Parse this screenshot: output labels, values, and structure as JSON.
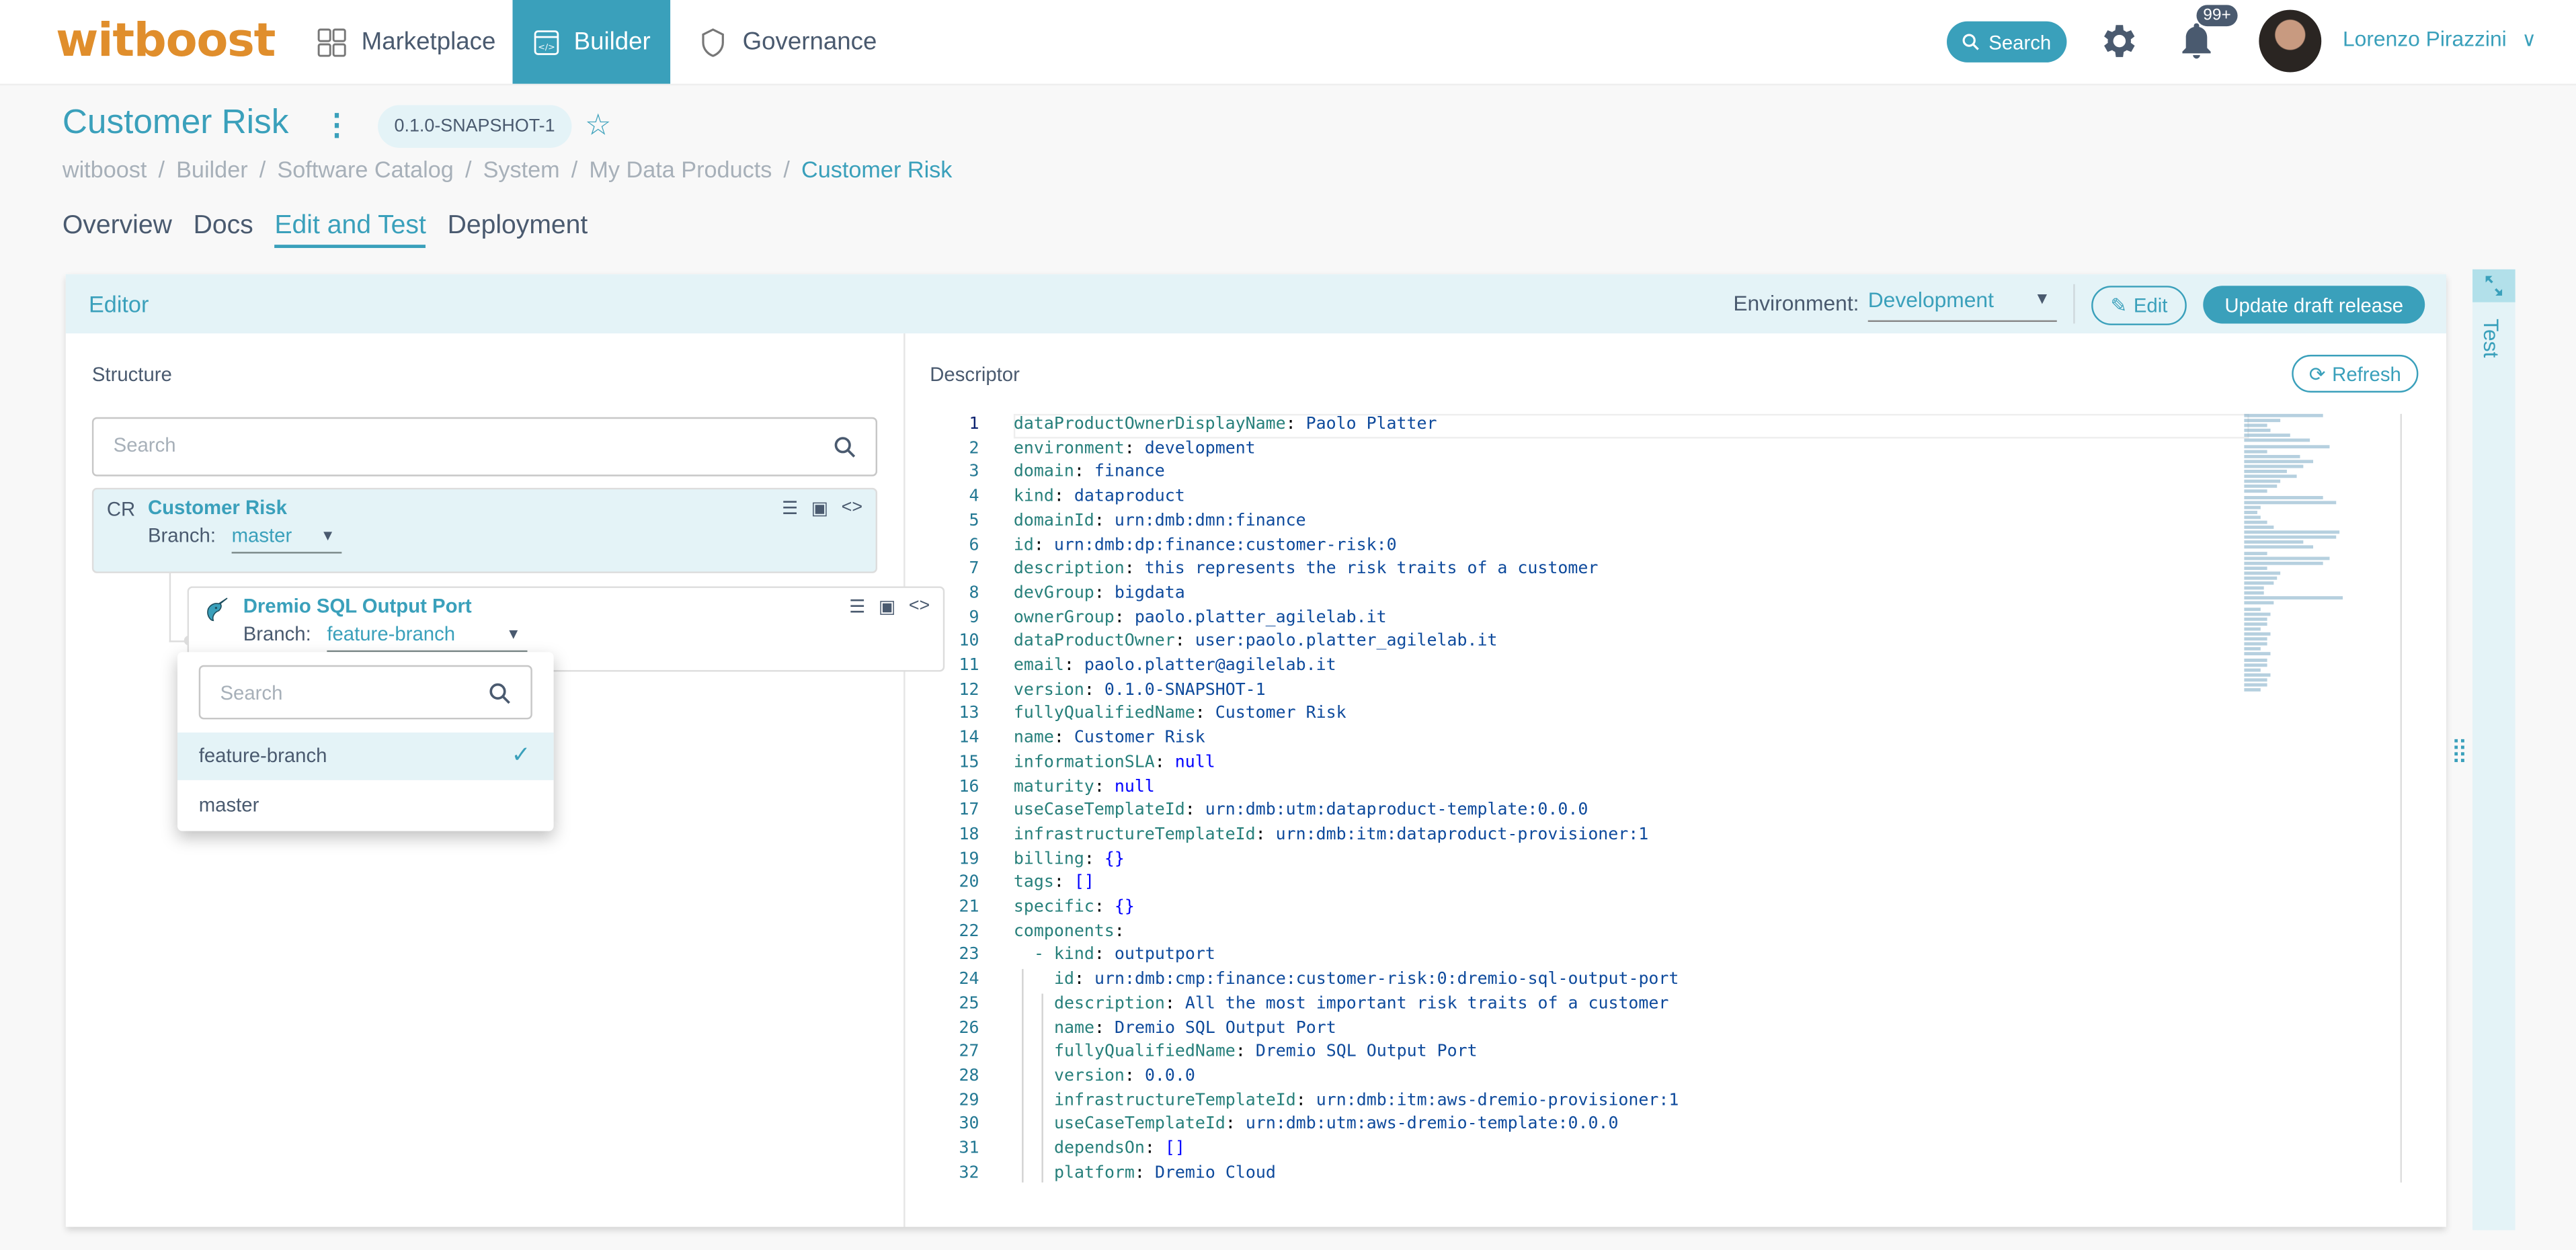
{
  "topbar": {
    "logo": "witboost",
    "nav": [
      {
        "label": "Marketplace",
        "icon": "marketplace-icon",
        "active": false
      },
      {
        "label": "Builder",
        "icon": "builder-icon",
        "active": true
      },
      {
        "label": "Governance",
        "icon": "shield-icon",
        "active": false
      }
    ],
    "search_label": "Search",
    "notifications_badge": "99+",
    "user_name": "Lorenzo Pirazzini"
  },
  "page": {
    "title": "Customer Risk",
    "version": "0.1.0-SNAPSHOT-1",
    "breadcrumb": [
      "witboost",
      "Builder",
      "Software Catalog",
      "System",
      "My Data Products",
      "Customer Risk"
    ],
    "tabs": [
      {
        "label": "Overview",
        "active": false
      },
      {
        "label": "Docs",
        "active": false
      },
      {
        "label": "Edit and Test",
        "active": true
      },
      {
        "label": "Deployment",
        "active": false
      }
    ]
  },
  "editor": {
    "title": "Editor",
    "environment_label": "Environment:",
    "environment_value": "Development",
    "edit_label": "Edit",
    "update_label": "Update draft release",
    "structure": {
      "label": "Structure",
      "search_placeholder": "Search",
      "root": {
        "abbr": "CR",
        "name": "Customer Risk",
        "branch_label": "Branch:",
        "branch": "master"
      },
      "child": {
        "name": "Dremio SQL Output Port",
        "branch_label": "Branch:",
        "branch": "feature-branch"
      }
    },
    "branch_menu": {
      "search_placeholder": "Search",
      "options": [
        {
          "label": "feature-branch",
          "selected": true
        },
        {
          "label": "master",
          "selected": false
        }
      ]
    },
    "descriptor": {
      "label": "Descriptor",
      "refresh_label": "Refresh",
      "lines": [
        {
          "n": "1",
          "indent": 0,
          "key": "dataProductOwnerDisplayName",
          "val": "Paolo Platter",
          "t": "v"
        },
        {
          "n": "2",
          "indent": 0,
          "key": "environment",
          "val": "development",
          "t": "v"
        },
        {
          "n": "3",
          "indent": 0,
          "key": "domain",
          "val": "finance",
          "t": "v"
        },
        {
          "n": "4",
          "indent": 0,
          "key": "kind",
          "val": "dataproduct",
          "t": "v"
        },
        {
          "n": "5",
          "indent": 0,
          "key": "domainId",
          "val": "urn:dmb:dmn:finance",
          "t": "v"
        },
        {
          "n": "6",
          "indent": 0,
          "key": "id",
          "val": "urn:dmb:dp:finance:customer-risk:0",
          "t": "v"
        },
        {
          "n": "7",
          "indent": 0,
          "key": "description",
          "val": "this represents the risk traits of a customer",
          "t": "v"
        },
        {
          "n": "8",
          "indent": 0,
          "key": "devGroup",
          "val": "bigdata",
          "t": "v"
        },
        {
          "n": "9",
          "indent": 0,
          "key": "ownerGroup",
          "val": "paolo.platter_agilelab.it",
          "t": "v"
        },
        {
          "n": "10",
          "indent": 0,
          "key": "dataProductOwner",
          "val": "user:paolo.platter_agilelab.it",
          "t": "v"
        },
        {
          "n": "11",
          "indent": 0,
          "key": "email",
          "val": "paolo.platter@agilelab.it",
          "t": "v"
        },
        {
          "n": "12",
          "indent": 0,
          "key": "version",
          "val": "0.1.0-SNAPSHOT-1",
          "t": "v"
        },
        {
          "n": "13",
          "indent": 0,
          "key": "fullyQualifiedName",
          "val": "Customer Risk",
          "t": "v"
        },
        {
          "n": "14",
          "indent": 0,
          "key": "name",
          "val": "Customer Risk",
          "t": "v"
        },
        {
          "n": "15",
          "indent": 0,
          "key": "informationSLA",
          "val": "null",
          "t": "n"
        },
        {
          "n": "16",
          "indent": 0,
          "key": "maturity",
          "val": "null",
          "t": "n"
        },
        {
          "n": "17",
          "indent": 0,
          "key": "useCaseTemplateId",
          "val": "urn:dmb:utm:dataproduct-template:0.0.0",
          "t": "v"
        },
        {
          "n": "18",
          "indent": 0,
          "key": "infrastructureTemplateId",
          "val": "urn:dmb:itm:dataproduct-provisioner:1",
          "t": "v"
        },
        {
          "n": "19",
          "indent": 0,
          "key": "billing",
          "val": "{}",
          "t": "n"
        },
        {
          "n": "20",
          "indent": 0,
          "key": "tags",
          "val": "[]",
          "t": "n"
        },
        {
          "n": "21",
          "indent": 0,
          "key": "specific",
          "val": "{}",
          "t": "n"
        },
        {
          "n": "22",
          "indent": 0,
          "key": "components",
          "val": "",
          "t": "v"
        },
        {
          "n": "23",
          "indent": 1,
          "key": "- kind",
          "val": "outputport",
          "t": "v"
        },
        {
          "n": "24",
          "indent": 2,
          "key": "id",
          "val": "urn:dmb:cmp:finance:customer-risk:0:dremio-sql-output-port",
          "t": "v"
        },
        {
          "n": "25",
          "indent": 2,
          "key": "description",
          "val": "All the most important risk traits of a customer",
          "t": "v"
        },
        {
          "n": "26",
          "indent": 2,
          "key": "name",
          "val": "Dremio SQL Output Port",
          "t": "v"
        },
        {
          "n": "27",
          "indent": 2,
          "key": "fullyQualifiedName",
          "val": "Dremio SQL Output Port",
          "t": "v"
        },
        {
          "n": "28",
          "indent": 2,
          "key": "version",
          "val": "0.0.0",
          "t": "v"
        },
        {
          "n": "29",
          "indent": 2,
          "key": "infrastructureTemplateId",
          "val": "urn:dmb:itm:aws-dremio-provisioner:1",
          "t": "v"
        },
        {
          "n": "30",
          "indent": 2,
          "key": "useCaseTemplateId",
          "val": "urn:dmb:utm:aws-dremio-template:0.0.0",
          "t": "v"
        },
        {
          "n": "31",
          "indent": 2,
          "key": "dependsOn",
          "val": "[]",
          "t": "n"
        },
        {
          "n": "32",
          "indent": 2,
          "key": "platform",
          "val": "Dremio Cloud",
          "t": "v"
        }
      ]
    }
  },
  "test_panel": {
    "label": "Test"
  },
  "colors": {
    "accent": "#3aa0bb",
    "logo": "#e08e2c",
    "panel_bg": "#e4f3f7",
    "text": "#4a5a6f"
  }
}
